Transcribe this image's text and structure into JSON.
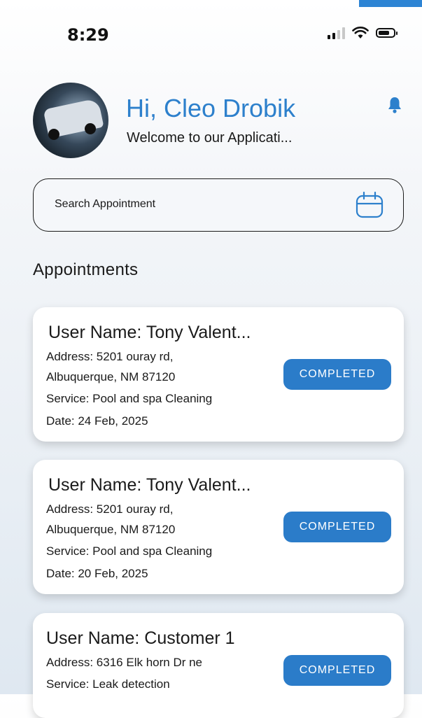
{
  "status_bar": {
    "time": "8:29",
    "signal_icon": "cellular-signal-icon",
    "wifi_icon": "wifi-icon",
    "battery_icon": "battery-icon"
  },
  "header": {
    "greeting": "Hi, Cleo Drobik",
    "subtitle": "Welcome to our Applicati...",
    "notification_icon": "bell-icon"
  },
  "search": {
    "placeholder": "Search Appointment",
    "calendar_icon": "calendar-icon"
  },
  "section_title": "Appointments",
  "appointments": [
    {
      "user_name": "User Name: Tony Valent...",
      "address_line1": "Address: 5201 ouray rd,",
      "address_line2": "Albuquerque,  NM 87120",
      "service": "Service: Pool and spa Cleaning",
      "date": "Date: 24 Feb, 2025",
      "status": "COMPLETED"
    },
    {
      "user_name": "User Name: Tony Valent...",
      "address_line1": "Address: 5201 ouray rd,",
      "address_line2": "Albuquerque,  NM 87120",
      "service": "Service: Pool and spa Cleaning",
      "date": "Date: 20 Feb, 2025",
      "status": "COMPLETED"
    },
    {
      "user_name": "User Name: Customer 1",
      "address_line1": "Address: 6316 Elk horn Dr ne",
      "service": "Service: Leak detection",
      "status": "COMPLETED"
    }
  ],
  "colors": {
    "accent": "#2d80cc",
    "badge": "#2b7cc9",
    "corner_tab": "#2d84d4"
  }
}
